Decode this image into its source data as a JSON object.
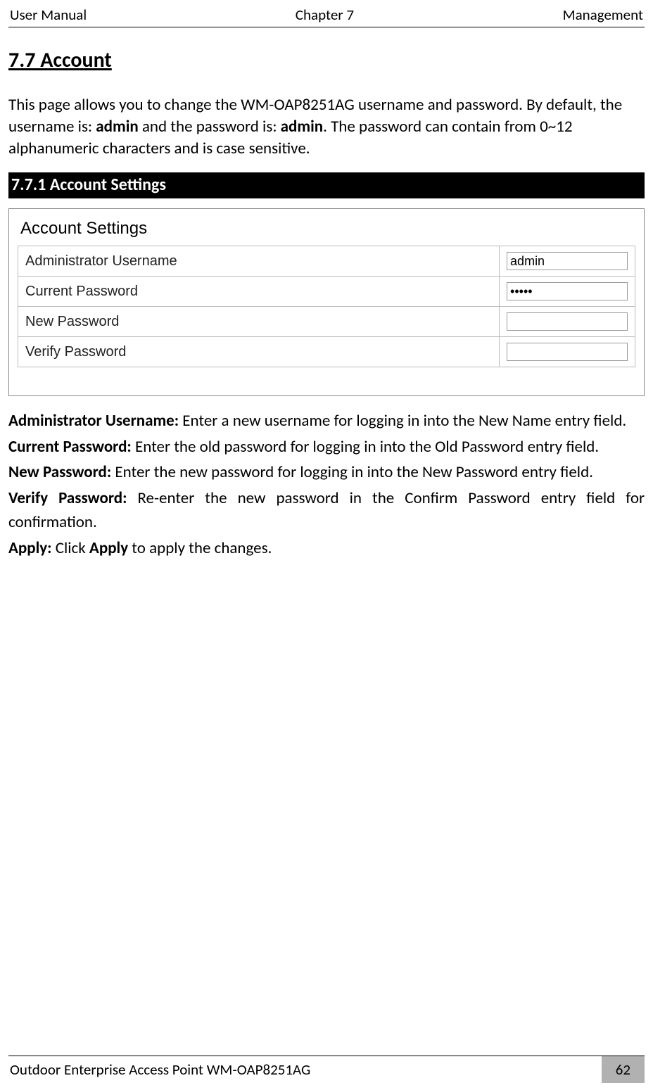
{
  "header": {
    "left": "User Manual",
    "center": "Chapter 7",
    "right": "Management"
  },
  "section": {
    "title": "7.7 Account",
    "intro_pre": "This page allows you to change the WM-OAP8251AG username and password. By default, the username is: ",
    "intro_b1": "admin",
    "intro_mid": " and the password is: ",
    "intro_b2": "admin",
    "intro_post": ". The password can contain from 0~12 alphanumeric characters and is case sensitive."
  },
  "subsection": {
    "bar": "7.7.1 Account Settings"
  },
  "screenshot": {
    "title": "Account Settings",
    "rows": {
      "admin_user_label": "Administrator Username",
      "admin_user_value": "admin",
      "current_pw_label": "Current Password",
      "current_pw_value": "•••••",
      "new_pw_label": "New Password",
      "new_pw_value": "",
      "verify_pw_label": "Verify Password",
      "verify_pw_value": ""
    }
  },
  "definitions": {
    "admin_user_b": "Administrator Username:",
    "admin_user_t": " Enter a new username for logging in into the New Name entry field.",
    "current_pw_b": "Current Password:",
    "current_pw_t": " Enter the old password for logging in into the Old Password entry field.",
    "new_pw_b": "New Password:",
    "new_pw_t": " Enter the new password for logging in into the New Password entry field.",
    "verify_pw_b": "Verify Password:",
    "verify_pw_t": " Re-enter the new password in the Confirm Password entry field for confirmation.",
    "apply_b": "Apply:",
    "apply_t1": " Click ",
    "apply_b2": "Apply",
    "apply_t2": " to apply the changes."
  },
  "footer": {
    "left": "Outdoor Enterprise Access Point WM-OAP8251AG",
    "page": "62"
  }
}
